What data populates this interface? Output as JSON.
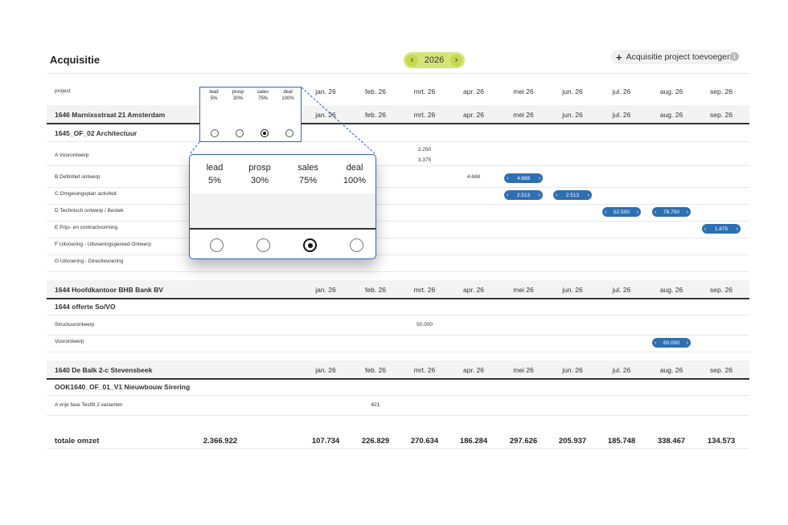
{
  "header": {
    "title": "Acquisitie",
    "year": "2026",
    "prev_icon": "chevron-left-icon",
    "next_icon": "chevron-right-icon",
    "add_label": "Acquisitie project toevoegen",
    "info_icon": "info-icon"
  },
  "columns": {
    "project": "project",
    "months": [
      "jan. 26",
      "feb. 26",
      "mrt. 26",
      "apr. 26",
      "mei 26",
      "jun. 26",
      "jul. 26",
      "aug. 26",
      "sep. 26"
    ]
  },
  "stages": [
    {
      "name": "lead",
      "pct": "5%"
    },
    {
      "name": "prosp",
      "pct": "30%"
    },
    {
      "name": "sales",
      "pct": "75%"
    },
    {
      "name": "deal",
      "pct": "100%"
    }
  ],
  "selected_stage": "sales",
  "groups": [
    {
      "title": "1646 Marnixsstraat 21 Amsterdam",
      "subtitle": "1645_OF_02 Architectuur",
      "rows": [
        {
          "label": "A Voorontwerp",
          "values": [
            {
              "month": "mrt. 26",
              "value": "2.250"
            },
            {
              "month": "mrt. 26",
              "value": "3.375"
            }
          ]
        },
        {
          "label": "B Definitief ontwerp",
          "values": [
            {
              "month": "apr. 26",
              "value": "4.688"
            }
          ],
          "pills": [
            {
              "month": "mei 26",
              "value": "4.688"
            }
          ]
        },
        {
          "label": "C Omgevingsplan activiteit",
          "pills": [
            {
              "month": "mei 26",
              "value": "2.513"
            },
            {
              "month": "jun. 26",
              "value": "2.513"
            }
          ]
        },
        {
          "label": "D Technisch ontwerp / Bestek",
          "pills": [
            {
              "month": "jul. 26",
              "value": "52.500"
            },
            {
              "month": "aug. 26",
              "value": "78.750"
            }
          ]
        },
        {
          "label": "E Prijs- en contractvorming",
          "pills": [
            {
              "month": "sep. 26",
              "value": "1.875"
            }
          ]
        },
        {
          "label": "F Uitvoering - Uitvoeringsgereed Ontwerp"
        },
        {
          "label": "G Uitvoering - Directievoering"
        }
      ]
    },
    {
      "title": "1644 Hoofdkantoor BHB Bank BV",
      "subtitle": "1644 offerte So/VO",
      "rows": [
        {
          "label": "Structuurontwerp",
          "values": [
            {
              "month": "mrt. 26",
              "value": "50.000"
            }
          ]
        },
        {
          "label": "Voorontwerp",
          "pills": [
            {
              "month": "aug. 26",
              "value": "60.000"
            }
          ]
        }
      ]
    },
    {
      "title": "1640 De Balk 2-c Stevensbeek",
      "subtitle": "OOK1640_OF_01_V1 Nieuwbouw Sirering",
      "rows": [
        {
          "label": "A vrije fase Testfit 2 varianten",
          "values": [
            {
              "month": "feb. 26",
              "value": "621"
            }
          ]
        }
      ]
    }
  ],
  "totals": {
    "label": "totale omzet",
    "total": "2.366.922",
    "months": [
      "107.734",
      "226.829",
      "270.634",
      "186.284",
      "297.626",
      "205.937",
      "185.748",
      "338.467",
      "134.573"
    ]
  },
  "colors": {
    "accent": "#d6e57a",
    "pill": "#2e6fb2",
    "focus": "#2f5fd0"
  }
}
